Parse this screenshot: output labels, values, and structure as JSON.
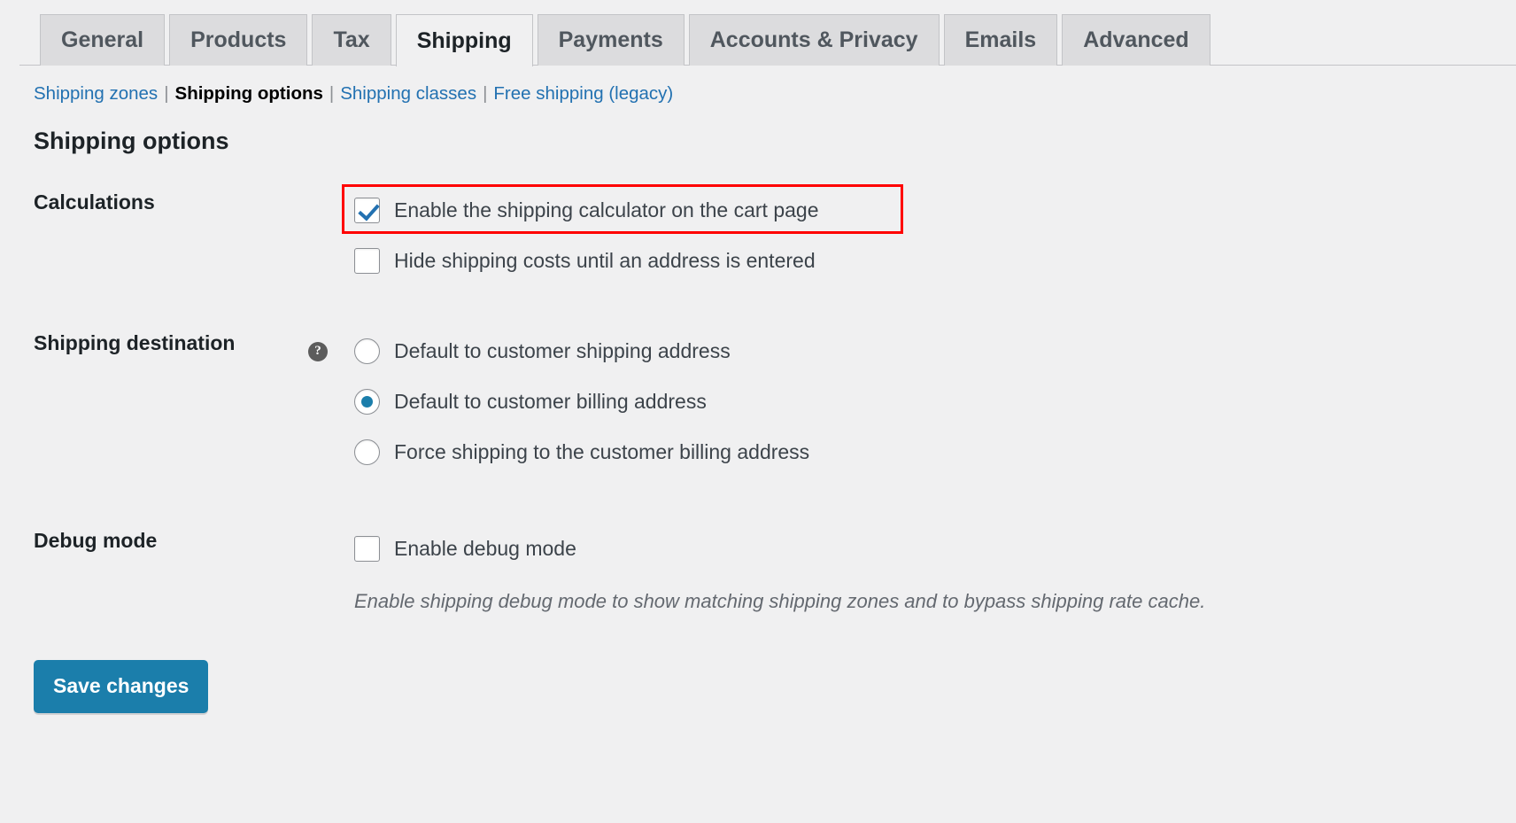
{
  "tabs": [
    {
      "label": "General",
      "active": false
    },
    {
      "label": "Products",
      "active": false
    },
    {
      "label": "Tax",
      "active": false
    },
    {
      "label": "Shipping",
      "active": true
    },
    {
      "label": "Payments",
      "active": false
    },
    {
      "label": "Accounts & Privacy",
      "active": false
    },
    {
      "label": "Emails",
      "active": false
    },
    {
      "label": "Advanced",
      "active": false
    }
  ],
  "subnav": {
    "separator": "|",
    "items": [
      {
        "label": "Shipping zones",
        "current": false
      },
      {
        "label": "Shipping options",
        "current": true
      },
      {
        "label": "Shipping classes",
        "current": false
      },
      {
        "label": "Free shipping (legacy)",
        "current": false
      }
    ]
  },
  "page_title": "Shipping options",
  "sections": {
    "calculations": {
      "label": "Calculations",
      "options": [
        {
          "label": "Enable the shipping calculator on the cart page",
          "checked": true,
          "highlighted": true
        },
        {
          "label": "Hide shipping costs until an address is entered",
          "checked": false,
          "highlighted": false
        }
      ]
    },
    "shipping_destination": {
      "label": "Shipping destination",
      "help_icon": "help-icon",
      "help_glyph": "?",
      "options": [
        {
          "label": "Default to customer shipping address",
          "selected": false
        },
        {
          "label": "Default to customer billing address",
          "selected": true
        },
        {
          "label": "Force shipping to the customer billing address",
          "selected": false
        }
      ]
    },
    "debug_mode": {
      "label": "Debug mode",
      "options": [
        {
          "label": "Enable debug mode",
          "checked": false
        }
      ],
      "description": "Enable shipping debug mode to show matching shipping zones and to bypass shipping rate cache."
    }
  },
  "submit": {
    "save_label": "Save changes"
  },
  "colors": {
    "accent_blue": "#1b7eab",
    "link_blue": "#2271b1",
    "page_bg": "#f0f0f1",
    "tab_bg": "#dcdcde",
    "border": "#c3c4c7",
    "highlight_red": "#ff0000",
    "text_dark": "#1d2327",
    "text_body": "#3c434a",
    "text_muted": "#646970"
  }
}
